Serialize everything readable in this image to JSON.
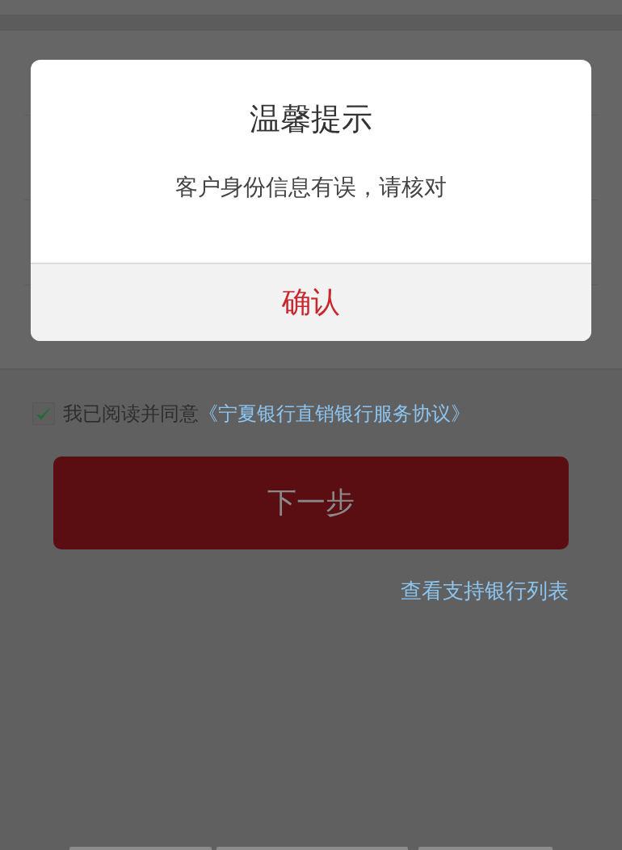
{
  "dialog": {
    "title": "温馨提示",
    "message": "客户身份信息有误，请核对",
    "button": "确认"
  },
  "agreement": {
    "checked": true,
    "prefix": "我已阅读并同意",
    "link": "《宁夏银行直销银行服务协议》"
  },
  "next_button": "下一步",
  "bank_list_link": "查看支持银行列表"
}
